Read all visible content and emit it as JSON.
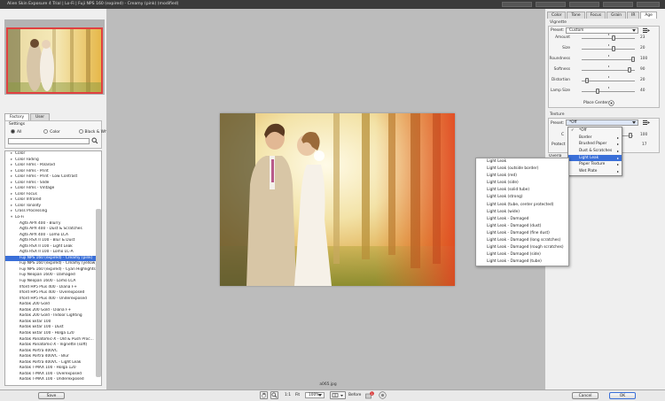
{
  "window": {
    "title": "Alien Skin Exposure 4 Trial | Lo-Fi | Fuji NPS 160 (expired) - Creamy (pink) (modified)"
  },
  "left": {
    "tabs": [
      "Factory",
      "User"
    ],
    "settings_label": "Settings",
    "color_modes": [
      "All",
      "Color",
      "Black & White"
    ],
    "search_placeholder": "",
    "categories": [
      "Color",
      "Color Fading",
      "Color Films - Polaroid",
      "Color Films - Print",
      "Color Films - Print - Low Contrast",
      "Color Films - Slide",
      "Color Films - Vintage",
      "Color Focus",
      "Color Infrared",
      "Color Tonality",
      "Cross Processing",
      "Lo-Fi"
    ],
    "lofi_items": [
      "Agfa APX 400 - Blurry",
      "Agfa APX 400 - Dust & Scratches",
      "Agfa APX 400 - Lomo LCA",
      "Agfa RSX II 100 - Blur & Dust",
      "Agfa RSX II 100 - Light Leak",
      "Agfa RSX II 100 - Lomo LC-A",
      "Fuji NPS 160 (expired) - Creamy (pink)",
      "Fuji NPS 160 (expired) - Creamy (yellow)",
      "Fuji NPS 160 (expired) - Cyan Highlights",
      "Fuji Neopan 1600 - Damaged",
      "Fuji Neopan 1600 - Lomo LCA",
      "Ilford HP5 Plus 400 - Diana F+",
      "Ilford HP5 Plus 400 - Overexposed",
      "Ilford HP5 Plus 400 - Underexposed",
      "Kodak 200 Gold",
      "Kodak 200 Gold - Diana F+",
      "Kodak 200 Gold - Indoor Lighting",
      "Kodak Ektar 100",
      "Kodak Ektar 100 - Dust",
      "Kodak Ektar 100 - Holga 120",
      "Kodak Panatomic-X - Old & Push Proc...",
      "Kodak Panatomic-X - Vignette (soft)",
      "Kodak Portra 400VC",
      "Kodak Portra 400VC - Blur",
      "Kodak Portra 400VC - Light Leak",
      "Kodak T-MAX 100 - Holga 120",
      "Kodak T-MAX 100 - Overexposed",
      "Kodak T-MAX 100 - Underexposed"
    ],
    "selected_index": 6,
    "save_label": "Save"
  },
  "canvas": {
    "filename": "a065.jpg"
  },
  "right": {
    "tabs": [
      "Color",
      "Tone",
      "Focus",
      "Grain",
      "IR",
      "Age"
    ],
    "active_tab": "Age",
    "vignette": {
      "title": "Vignette",
      "preset_label": "Preset:",
      "preset_value": "Custom",
      "sliders": [
        {
          "label": "Amount",
          "value": "23",
          "pos": 0.6
        },
        {
          "label": "Size",
          "value": "20",
          "pos": 0.6
        },
        {
          "label": "Roundness",
          "value": "100",
          "pos": 0.97
        },
        {
          "label": "Softness",
          "value": "90",
          "pos": 0.9
        },
        {
          "label": "Distortion",
          "value": "20",
          "pos": 0.1
        },
        {
          "label": "Lamp Size",
          "value": "40",
          "pos": 0.3
        }
      ],
      "place_center_label": "Place Center:"
    },
    "texture": {
      "title": "Texture",
      "preset_label": "Preset:",
      "preset_value": "*Off",
      "row_labels": [
        "C",
        "Protect"
      ],
      "row_values": [
        "100",
        "17"
      ],
      "partial_label": "Overlay"
    },
    "preset_menu": [
      {
        "label": "*Off",
        "checked": true,
        "sub": false
      },
      {
        "label": "Border",
        "checked": false,
        "sub": true
      },
      {
        "label": "Brushed Paper",
        "checked": false,
        "sub": true
      },
      {
        "label": "Dust & Scratches",
        "checked": false,
        "sub": true
      },
      {
        "label": "Light Leak",
        "checked": false,
        "sub": true
      },
      {
        "label": "Paper Texture",
        "checked": false,
        "sub": true
      },
      {
        "label": "Wet Plate",
        "checked": false,
        "sub": true
      }
    ],
    "submenu": [
      "Light Leak",
      "Light Leak (outside border)",
      "Light Leak (red)",
      "Light Leak (side)",
      "Light Leak (solid tube)",
      "Light Leak (strong)",
      "Light Leak (tube, center protected)",
      "Light Leak (wide)",
      "Light Leak - Damaged",
      "Light Leak - Damaged (dust)",
      "Light Leak - Damaged (fine dust)",
      "Light Leak - Damaged (long scratches)",
      "Light Leak - Damaged (rough scratches)",
      "Light Leak - Damaged (side)",
      "Light Leak - Damaged (tube)"
    ]
  },
  "bottom": {
    "zoom_1to1": "1:1",
    "fit": "Fit",
    "zoom_value": "100%",
    "before_label": "Before",
    "badge": "1",
    "cancel_label": "Cancel",
    "ok_label": "OK"
  },
  "colors": {
    "selection": "#3a6fd8",
    "canvas_bg": "#bcbcbc",
    "thumb_border": "#e04040"
  }
}
